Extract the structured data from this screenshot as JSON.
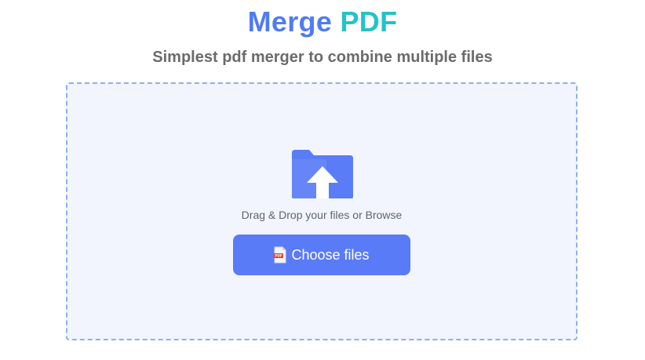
{
  "header": {
    "title_part1": "Merge",
    "title_part2": "PDF",
    "subtitle": "Simplest pdf merger to combine multiple files"
  },
  "dropzone": {
    "icon": "folder-upload-icon",
    "hint": "Drag & Drop your files or Browse",
    "button_label": "Choose files",
    "button_icon": "pdf-file-icon"
  },
  "colors": {
    "title_primary": "#4f7cf2",
    "title_accent": "#20c4c8",
    "subtitle": "#6b6b6b",
    "dropzone_border": "#8eaef0",
    "dropzone_background": "#f2f5fd",
    "button_background": "#5a7bf7",
    "button_text": "#ffffff",
    "folder_icon": "#5b7cf7"
  }
}
